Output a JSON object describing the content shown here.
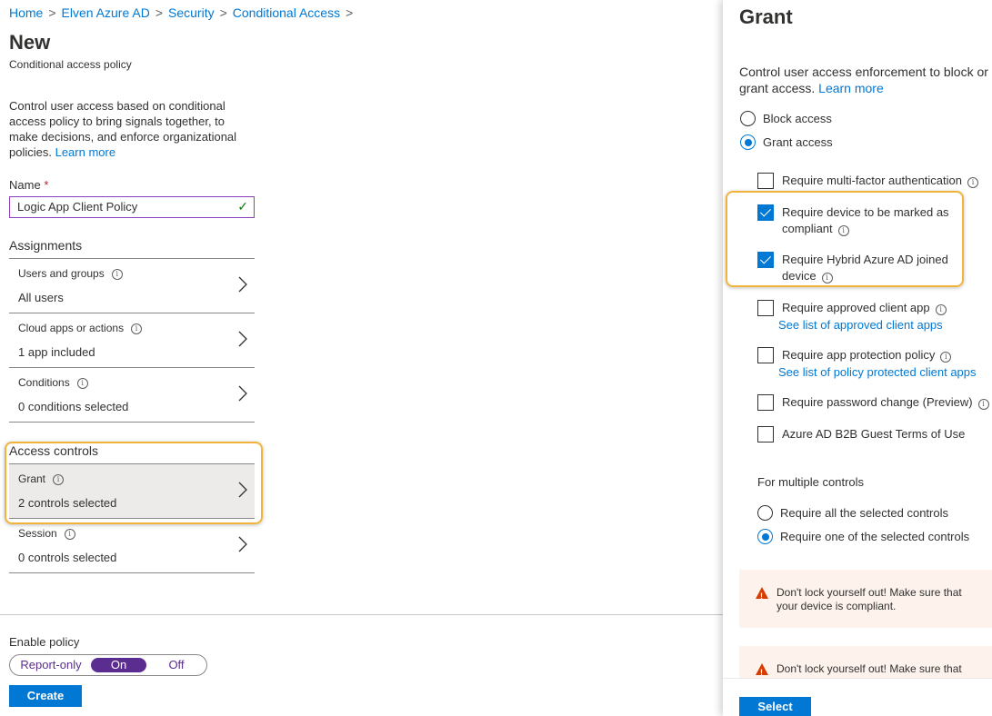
{
  "breadcrumb": [
    "Home",
    "Elven Azure AD",
    "Security",
    "Conditional Access"
  ],
  "page": {
    "title": "New",
    "subtitle": "Conditional access policy"
  },
  "description": "Control user access based on conditional access policy to bring signals together, to make decisions, and enforce organizational policies.",
  "learn_more": "Learn more",
  "name_field": {
    "label": "Name",
    "required_mark": "*",
    "value": "Logic App Client Policy"
  },
  "assignments": {
    "title": "Assignments",
    "items": [
      {
        "label": "Users and groups",
        "value": "All users"
      },
      {
        "label": "Cloud apps or actions",
        "value": "1 app included"
      },
      {
        "label": "Conditions",
        "value": "0 conditions selected"
      }
    ]
  },
  "access_controls": {
    "title": "Access controls",
    "items": [
      {
        "label": "Grant",
        "value": "2 controls selected"
      },
      {
        "label": "Session",
        "value": "0 controls selected"
      }
    ]
  },
  "enable_policy": {
    "label": "Enable policy",
    "options": [
      "Report-only",
      "On",
      "Off"
    ],
    "selected": "On"
  },
  "create_button": "Create",
  "grant": {
    "title": "Grant",
    "description": "Control user access enforcement to block or grant access.",
    "learn_more": "Learn more",
    "access_options": [
      {
        "label": "Block access",
        "selected": false
      },
      {
        "label": "Grant access",
        "selected": true
      }
    ],
    "controls": [
      {
        "label": "Require multi-factor authentication",
        "checked": false
      },
      {
        "label": "Require device to be marked as compliant",
        "checked": true
      },
      {
        "label": "Require Hybrid Azure AD joined device",
        "checked": true
      },
      {
        "label": "Require approved client app",
        "checked": false,
        "link": "See list of approved client apps"
      },
      {
        "label": "Require app protection policy",
        "checked": false,
        "link": "See list of policy protected client apps"
      },
      {
        "label": "Require password change (Preview)",
        "checked": false
      },
      {
        "label": "Azure AD B2B Guest Terms of Use",
        "checked": false
      }
    ],
    "multiple_controls": {
      "label": "For multiple controls",
      "options": [
        {
          "label": "Require all the selected controls",
          "selected": false
        },
        {
          "label": "Require one of the selected controls",
          "selected": true
        }
      ]
    },
    "warnings": [
      "Don't lock yourself out! Make sure that your device is compliant.",
      "Don't lock yourself out! Make sure that your device is Hybrid Azure AD joined."
    ],
    "select_button": "Select"
  },
  "colors": {
    "accent": "#0078d4",
    "toggle_on": "#5c2d91",
    "highlight": "#f2b33d",
    "warning": "#d83b01"
  }
}
